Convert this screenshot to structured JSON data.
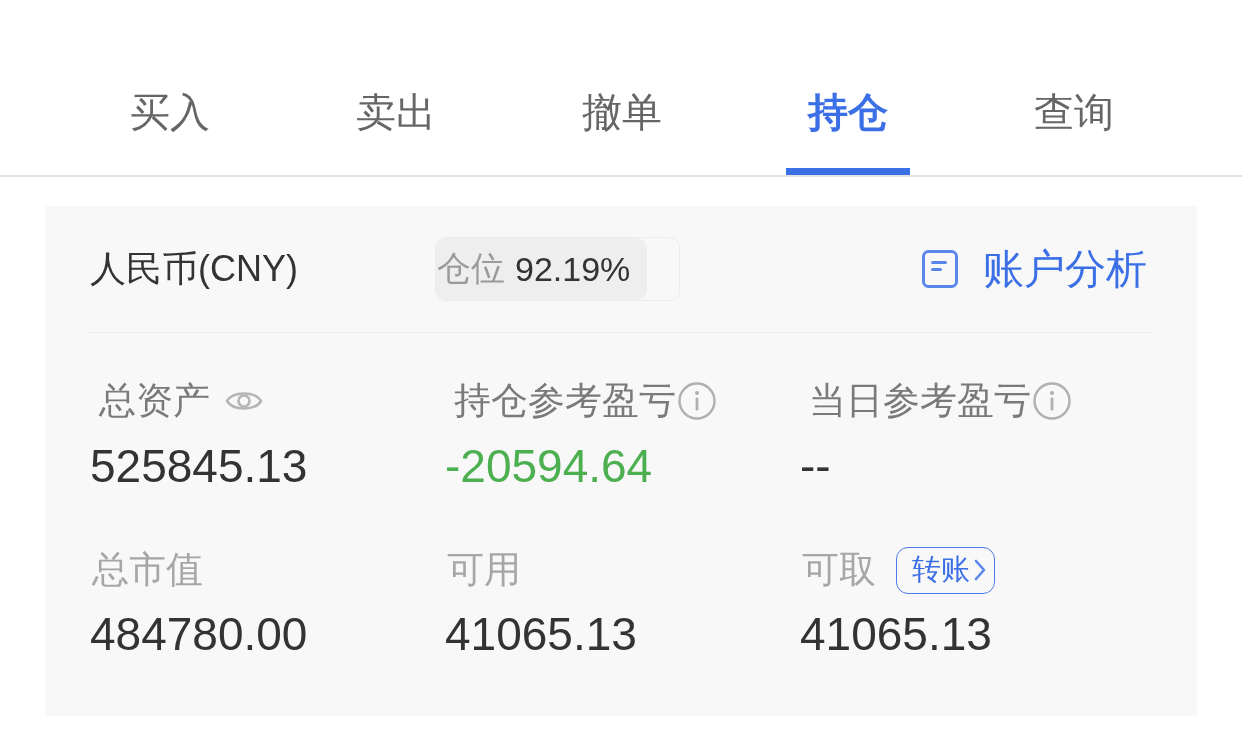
{
  "tabs": [
    {
      "label": "买入",
      "selected": false
    },
    {
      "label": "卖出",
      "selected": false
    },
    {
      "label": "撤单",
      "selected": false
    },
    {
      "label": "持仓",
      "selected": true
    },
    {
      "label": "查询",
      "selected": false
    }
  ],
  "account": {
    "currency": "人民币(CNY)",
    "position": {
      "label": "仓位",
      "value": "92.19%",
      "level": 0.87
    },
    "analysis_link": "账户分析"
  },
  "stats": {
    "rows": [
      [
        {
          "label": "总资产",
          "kind": "eye",
          "value": "525845.13",
          "color": "#333333"
        },
        {
          "label": "持仓参考盈亏",
          "kind": "info",
          "value": "-20594.64",
          "color": "#4caf50"
        },
        {
          "label": "当日参考盈亏",
          "kind": "info",
          "value": "--",
          "color": "#333333"
        }
      ],
      [
        {
          "label": "总市值",
          "kind": "plain",
          "value": "484780.00",
          "color": "#333333"
        },
        {
          "label": "可用",
          "kind": "plain",
          "value": "41065.13",
          "color": "#333333"
        },
        {
          "label": "可取",
          "kind": "transfer",
          "button": "转账",
          "value": "41065.13",
          "color": "#333333"
        }
      ]
    ]
  }
}
